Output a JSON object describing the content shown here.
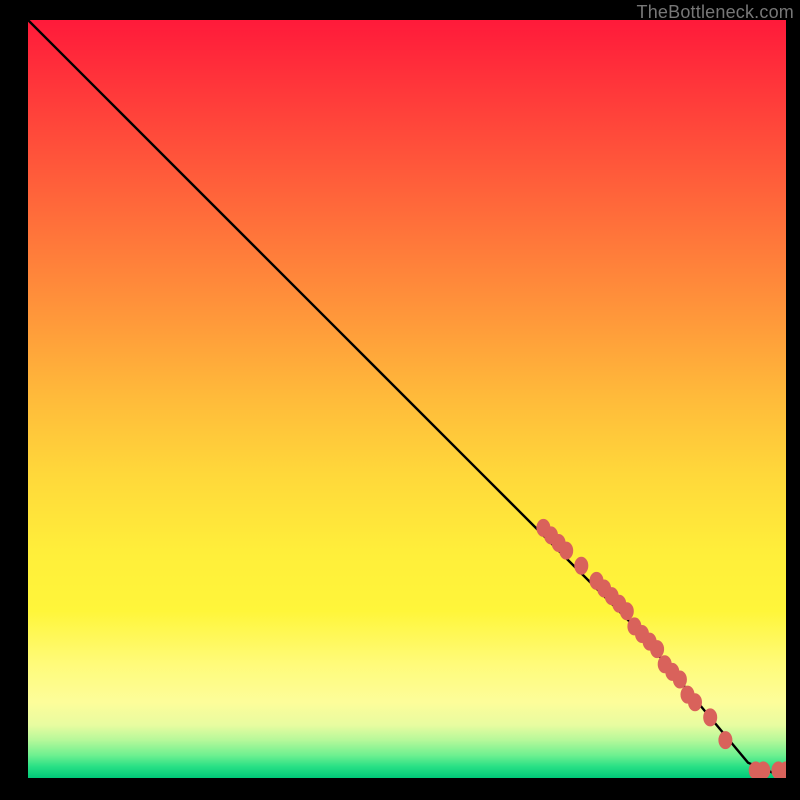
{
  "attribution": "TheBottleneck.com",
  "colors": {
    "curve": "#000000",
    "points": "#d9625b",
    "gradient_top": "#ff1a3a",
    "gradient_bottom": "#00c878"
  },
  "chart_data": {
    "type": "line",
    "title": "",
    "xlabel": "",
    "ylabel": "",
    "xlim": [
      0,
      100
    ],
    "ylim": [
      0,
      100
    ],
    "grid": false,
    "series": [
      {
        "name": "curve",
        "x": [
          0,
          4,
          10,
          20,
          30,
          40,
          50,
          60,
          70,
          80,
          90,
          95,
          100
        ],
        "y": [
          100,
          96,
          90,
          80,
          70,
          60,
          50,
          40,
          30,
          20,
          8,
          2,
          0
        ]
      }
    ],
    "points": [
      {
        "x": 68,
        "y": 33
      },
      {
        "x": 69,
        "y": 32
      },
      {
        "x": 70,
        "y": 31
      },
      {
        "x": 71,
        "y": 30
      },
      {
        "x": 73,
        "y": 28
      },
      {
        "x": 75,
        "y": 26
      },
      {
        "x": 76,
        "y": 25
      },
      {
        "x": 77,
        "y": 24
      },
      {
        "x": 78,
        "y": 23
      },
      {
        "x": 79,
        "y": 22
      },
      {
        "x": 80,
        "y": 20
      },
      {
        "x": 81,
        "y": 19
      },
      {
        "x": 82,
        "y": 18
      },
      {
        "x": 83,
        "y": 17
      },
      {
        "x": 84,
        "y": 15
      },
      {
        "x": 85,
        "y": 14
      },
      {
        "x": 86,
        "y": 13
      },
      {
        "x": 87,
        "y": 11
      },
      {
        "x": 88,
        "y": 10
      },
      {
        "x": 90,
        "y": 8
      },
      {
        "x": 92,
        "y": 5
      },
      {
        "x": 96,
        "y": 1
      },
      {
        "x": 97,
        "y": 1
      },
      {
        "x": 99,
        "y": 1
      },
      {
        "x": 100,
        "y": 1
      }
    ]
  }
}
